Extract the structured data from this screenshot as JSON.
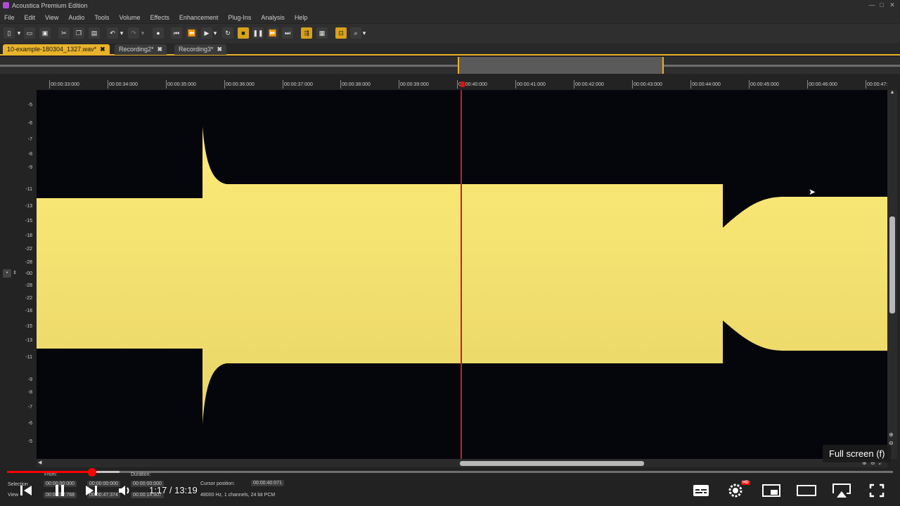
{
  "app": {
    "title": "Acoustica Premium Edition",
    "window_controls": [
      "—",
      "□",
      "✕"
    ]
  },
  "menu": [
    "File",
    "Edit",
    "View",
    "Audio",
    "Tools",
    "Volume",
    "Effects",
    "Enhancement",
    "Plug-Ins",
    "Analysis",
    "Help"
  ],
  "tabs": [
    {
      "label": "10-example-180304_1327.wav*",
      "active": true,
      "close": "✖"
    },
    {
      "label": "Recording2*",
      "active": false,
      "close": "✖"
    },
    {
      "label": "Recording3*",
      "active": false,
      "close": "✖"
    }
  ],
  "ruler_ticks": [
    "00:00:33:000",
    "00:00:34:000",
    "00:00:35:000",
    "00:00:36:000",
    "00:00:37:000",
    "00:00:38:000",
    "00:00:39:000",
    "00:00:40:000",
    "00:00:41:000",
    "00:00:42:000",
    "00:00:43:000",
    "00:00:44:000",
    "00:00:45:000",
    "00:00:46:000",
    "00:00:47:"
  ],
  "db_scale": [
    "-5",
    "-6",
    "-7",
    "-8",
    "-9",
    "-11",
    "-13",
    "-15",
    "-18",
    "-22",
    "-28",
    "-00",
    "-28",
    "-22",
    "-18",
    "-15",
    "-13",
    "-11",
    "-9",
    "-8",
    "-7",
    "-6",
    "-5"
  ],
  "colors": {
    "waveform": "#fdeb77",
    "waveform_dark": "#e8d568",
    "playhead": "#c81e1e",
    "accent": "#e8b22a",
    "youtube_red": "#ff0000"
  },
  "bottom": {
    "selection_label": "Selection",
    "view_label": "View",
    "from_label": "From:",
    "to_label": "To:",
    "duration_label": "Duration:",
    "from_value": "00:00:00:000",
    "from_value_view": "00:00:32:768",
    "to_value": "00:00:00:000",
    "to_value_view": "00:00:47:374",
    "duration_value": "00:00:00:000",
    "duration_value_view": "00:00:14:607",
    "cursor_label": "Cursor position:",
    "cursor_value": "00:00:40:071",
    "format_info": "48000 Hz, 1 channels, 24 bit PCM"
  },
  "player": {
    "time": "1:17 / 13:19",
    "tooltip": "Full screen (f)",
    "hd_badge": "HD",
    "progress_played": 0.096,
    "progress_loaded": 0.127
  }
}
